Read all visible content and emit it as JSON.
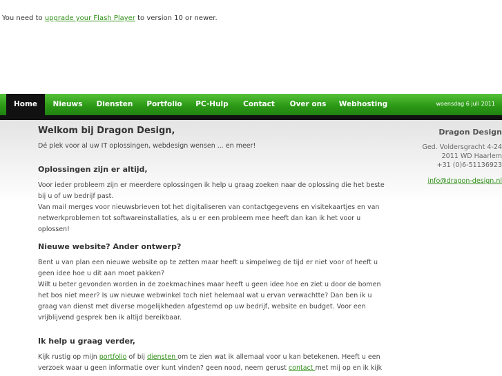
{
  "flash": {
    "prefix": "You need to ",
    "link": "upgrade your Flash Player",
    "suffix": " to version 10 or newer."
  },
  "nav": {
    "items": [
      "Home",
      "Nieuws",
      "Diensten",
      "Portfolio",
      "PC-Hulp",
      "Contact",
      "Over ons",
      "Webhosting"
    ],
    "date": "woensdag 6 juli 2011"
  },
  "main": {
    "title": "Welkom bij Dragon Design,",
    "intro": "Dé plek voor al uw IT oplossingen, webdesign wensen ... en meer!",
    "section1": {
      "heading": "Oplossingen zijn er altijd,",
      "p1": "Voor ieder probleem zijn er meerdere oplossingen ik help u graag zoeken naar de oplossing die het beste bij u of uw bedrijf past.",
      "p2": "Van mail merges voor nieuwsbrieven tot het digitaliseren van contactgegevens en visitekaartjes en van netwerkproblemen tot softwareinstallaties, als u er een probleem mee heeft dan kan ik het voor u oplossen!"
    },
    "section2": {
      "heading": "Nieuwe website? Ander ontwerp?",
      "p1": "Bent u van plan een nieuwe website op te zetten maar heeft u simpelweg de tijd er niet voor of heeft u geen idee hoe u dit aan moet pakken?",
      "p2": "Wilt u beter gevonden worden in de zoekmachines maar heeft u geen idee hoe en ziet u door de bomen het bos niet meer? Is uw nieuwe webwinkel toch niet helemaal wat u ervan verwachtte? Dan ben ik u graag van dienst met diverse mogelijkheden afgestemd op uw bedrijf, website en budget. Voor een vrijblijvend gesprek ben ik altijd bereikbaar."
    },
    "section3": {
      "heading": "Ik help u graag verder,",
      "t1": "Kijk rustig op mijn ",
      "link_portfolio": "portfolio",
      "t2": " of bij ",
      "link_diensten": "diensten ",
      "t3": "om te zien wat ik allemaal voor u kan betekenen. Heeft u een verzoek waar u geen informatie over kunt vinden? geen nood, neem gerust ",
      "link_contact": "contact ",
      "t4": "met mij op en ik kijk"
    }
  },
  "sidebar": {
    "company": "Dragon Design",
    "address1": "Ged. Voldersgracht 4-24",
    "address2": "2011 WD Haarlem",
    "phone": "+31 (0)6-51136923",
    "email": "info@dragon-design.nl"
  }
}
